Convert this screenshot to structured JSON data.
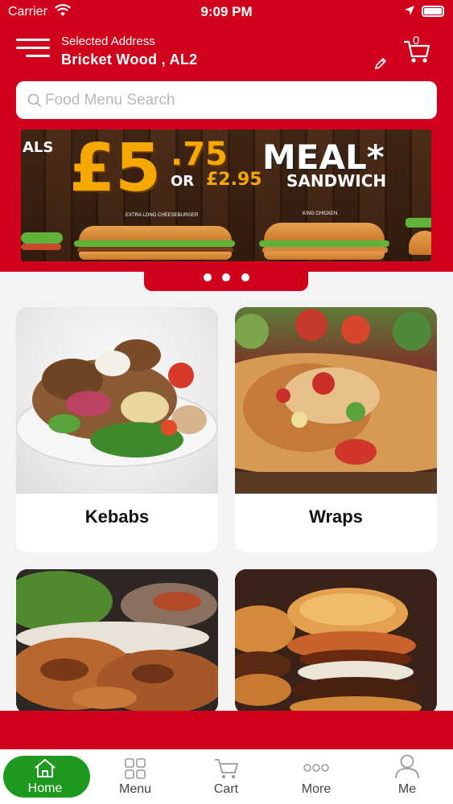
{
  "status_bar": {
    "carrier": "Carrier",
    "time": "9:09 PM"
  },
  "header": {
    "address_label": "Selected Address",
    "address_value": "Bricket Wood , AL2",
    "cart_count": "0"
  },
  "search": {
    "placeholder": "Food Menu Search"
  },
  "banner": {
    "left_text": "ALS",
    "price_whole": "£5",
    "price_cents": ".75",
    "meal": "MEAL*",
    "or": "OR",
    "price_sandwich": "£2.95",
    "sandwich": "SANDWICH",
    "caption_left": "EXTRA LONG CHEESEBURGER",
    "caption_right": "KING CHICKEN",
    "pages": 3
  },
  "categories": [
    {
      "label": "Kebabs"
    },
    {
      "label": "Wraps"
    },
    {
      "label": ""
    },
    {
      "label": ""
    }
  ],
  "tabbar": {
    "items": [
      {
        "label": "Home",
        "icon": "home-icon",
        "active": true
      },
      {
        "label": "Menu",
        "icon": "grid-icon",
        "active": false
      },
      {
        "label": "Cart",
        "icon": "cart-icon",
        "active": false
      },
      {
        "label": "More",
        "icon": "more-icon",
        "active": false
      },
      {
        "label": "Me",
        "icon": "user-icon",
        "active": false
      }
    ]
  },
  "colors": {
    "brand_red": "#d1031c",
    "active_green": "#1d9a1f",
    "accent_yellow": "#f5a800"
  }
}
